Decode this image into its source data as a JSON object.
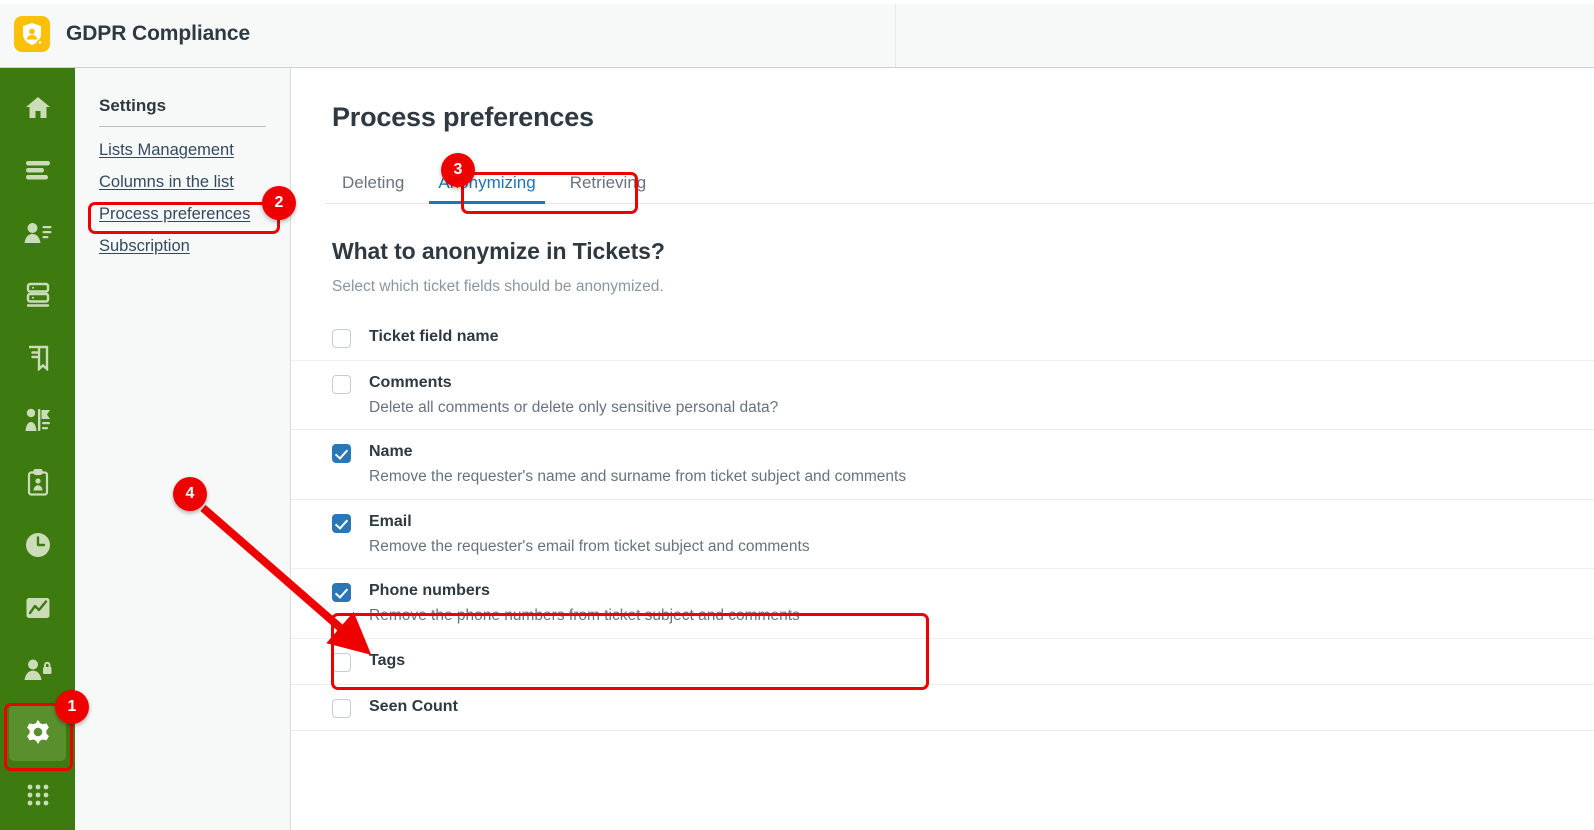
{
  "header": {
    "app_title": "GDPR Compliance",
    "logo_icon": "shield-user-icon",
    "logo_color": "#fbc108"
  },
  "rail": {
    "background_color": "#3d7a0f",
    "active_color": "#5a8f2e",
    "items": [
      {
        "icon": "home-icon",
        "name": "rail-item-home",
        "active": false
      },
      {
        "icon": "list-icon",
        "name": "rail-item-lists",
        "active": false
      },
      {
        "icon": "user-details-icon",
        "name": "rail-item-contacts",
        "active": false
      },
      {
        "icon": "database-icon",
        "name": "rail-item-database",
        "active": false
      },
      {
        "icon": "book-icon",
        "name": "rail-item-book",
        "active": false
      },
      {
        "icon": "flag-person-icon",
        "name": "rail-item-requests",
        "active": false
      },
      {
        "icon": "clipboard-user-icon",
        "name": "rail-item-clipboard",
        "active": false
      },
      {
        "icon": "clock-icon",
        "name": "rail-item-history",
        "active": false
      },
      {
        "icon": "chart-icon",
        "name": "rail-item-reports",
        "active": false
      },
      {
        "icon": "user-lock-icon",
        "name": "rail-item-privacy",
        "active": false
      },
      {
        "icon": "gear-icon",
        "name": "rail-item-settings",
        "active": true
      },
      {
        "icon": "grid-apps-icon",
        "name": "rail-item-apps",
        "active": false
      }
    ]
  },
  "settings": {
    "title": "Settings",
    "links": [
      {
        "label": "Lists Management",
        "active": false
      },
      {
        "label": "Columns in the list",
        "active": false
      },
      {
        "label": "Process preferences",
        "active": true
      },
      {
        "label": "Subscription",
        "active": false
      }
    ]
  },
  "main": {
    "page_title": "Process preferences",
    "tabs": [
      {
        "label": "Deleting",
        "active": false
      },
      {
        "label": "Anonymizing",
        "active": true
      },
      {
        "label": "Retrieving",
        "active": false
      }
    ],
    "active_tab_color": "#1f73b7",
    "section_heading": "What to anonymize in Tickets?",
    "section_subtitle": "Select which ticket fields should be anonymized.",
    "fields": [
      {
        "label": "Ticket field name",
        "desc": "",
        "checked": false
      },
      {
        "label": "Comments",
        "desc": "Delete all comments or delete only sensitive personal data?",
        "checked": false
      },
      {
        "label": "Name",
        "desc": "Remove the requester's name and surname from ticket subject and comments",
        "checked": true
      },
      {
        "label": "Email",
        "desc": "Remove the requester's email from ticket subject and comments",
        "checked": true
      },
      {
        "label": "Phone numbers",
        "desc": "Remove the phone numbers from ticket subject and comments",
        "checked": true
      },
      {
        "label": "Tags",
        "desc": "",
        "checked": false
      },
      {
        "label": "Seen Count",
        "desc": "",
        "checked": false
      }
    ],
    "checkbox_checked_color": "#2a77b8"
  },
  "annotations": {
    "color": "#ee0000",
    "badges": [
      {
        "label": "1",
        "target": "rail-item-settings"
      },
      {
        "label": "2",
        "target": "settings-link-process-preferences"
      },
      {
        "label": "3",
        "target": "tab-anonymizing"
      },
      {
        "label": "4",
        "target": "field-row-phone-numbers"
      }
    ]
  }
}
